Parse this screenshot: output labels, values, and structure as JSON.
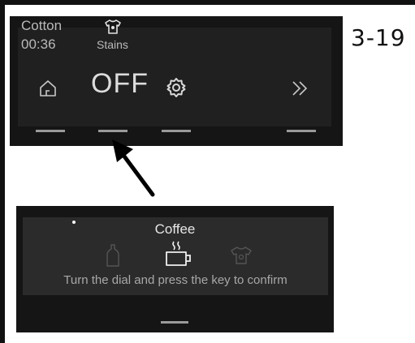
{
  "figure_number": "3-19",
  "top_display": {
    "program_name": "Cotton",
    "time_remaining": "00:36",
    "option_label": "Stains",
    "option_value": "OFF",
    "icons": [
      "stains-shirt-icon",
      "home-icon",
      "gear-icon",
      "forward-double-chevron-icon"
    ]
  },
  "bottom_display": {
    "title": "Coffee",
    "instruction": "Turn the dial and press the key to confirm",
    "icons": [
      "bottle-icon",
      "coffee-cup-icon",
      "shirt-icon"
    ]
  },
  "colors": {
    "panel_bg": "#151515",
    "screen_bg": "#202020",
    "text_primary": "#dcdcdc",
    "text_secondary": "#a8a8a8"
  }
}
